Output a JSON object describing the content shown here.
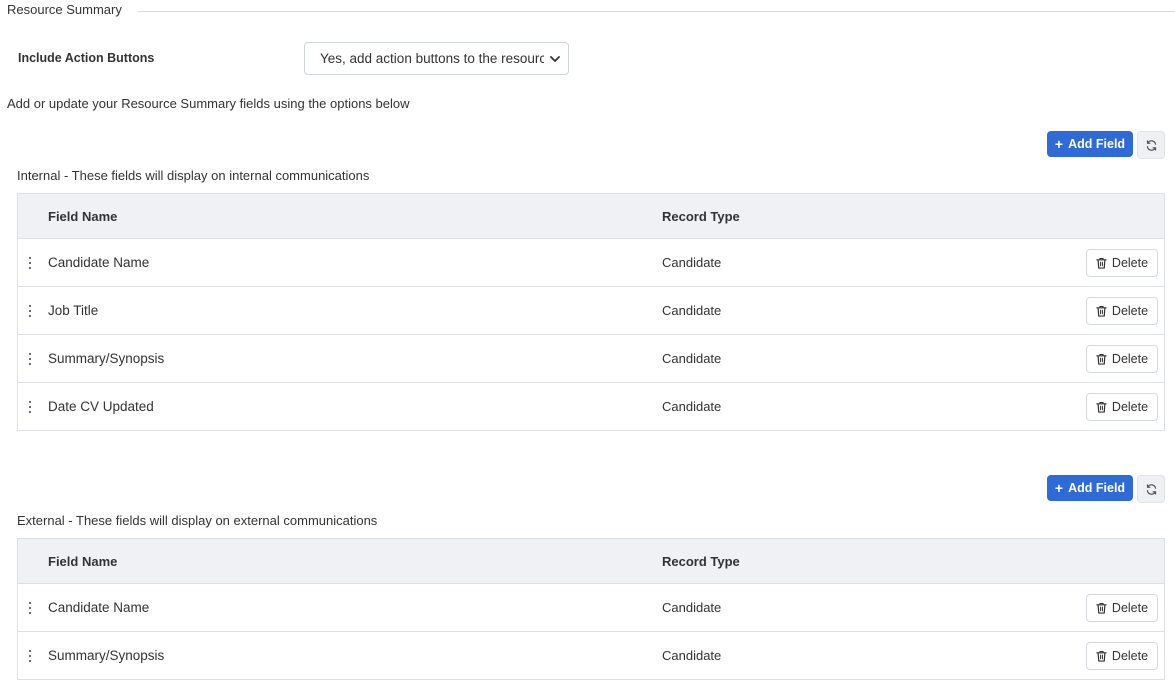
{
  "legend": {
    "title": "Resource Summary"
  },
  "include_action_buttons": {
    "label": "Include Action Buttons",
    "selected": "Yes, add action buttons to the resource summary"
  },
  "help_text": "Add or update your Resource Summary fields using the options below",
  "toolbar": {
    "add_label": "Add Field"
  },
  "internal": {
    "title": "Internal - These fields will display on internal communications",
    "columns": {
      "name": "Field Name",
      "type": "Record Type"
    },
    "rows": [
      {
        "name": "Candidate Name",
        "type": "Candidate",
        "action": "Delete"
      },
      {
        "name": "Job Title",
        "type": "Candidate",
        "action": "Delete"
      },
      {
        "name": "Summary/Synopsis",
        "type": "Candidate",
        "action": "Delete"
      },
      {
        "name": "Date CV Updated",
        "type": "Candidate",
        "action": "Delete"
      }
    ]
  },
  "external": {
    "title": "External - These fields will display on external communications",
    "columns": {
      "name": "Field Name",
      "type": "Record Type"
    },
    "rows": [
      {
        "name": "Candidate Name",
        "type": "Candidate",
        "action": "Delete"
      },
      {
        "name": "Summary/Synopsis",
        "type": "Candidate",
        "action": "Delete"
      }
    ]
  },
  "icons": {
    "add": "plus-icon",
    "refresh": "refresh-icon",
    "delete": "trash-icon",
    "drag": "drag-handle-icon",
    "dropdown": "chevron-down-icon"
  },
  "colors": {
    "primary": "#2f6bd8",
    "header_bg": "#eff1f4",
    "border": "#dcdfe4"
  }
}
